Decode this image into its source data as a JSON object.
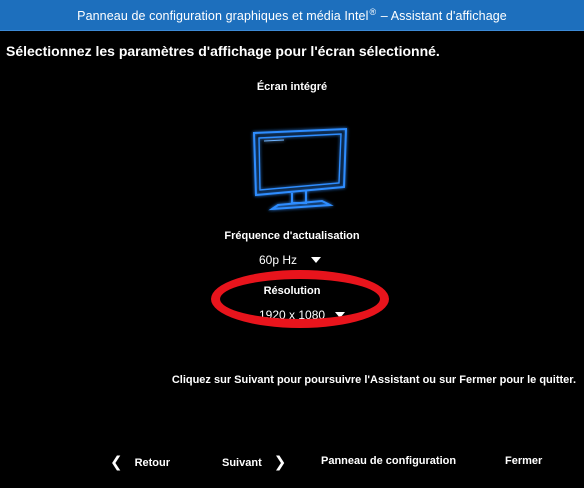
{
  "window": {
    "title_main": "Panneau de configuration graphiques et média Intel",
    "title_mark": "®",
    "title_sep": " – ",
    "title_section": "Assistant d'affichage"
  },
  "heading": "Sélectionnez les paramètres d'affichage pour l'écran sélectionné.",
  "display": {
    "name": "Écran intégré",
    "icon": "monitor-icon",
    "glow_color": "#2f8dff"
  },
  "refresh": {
    "label": "Fréquence d'actualisation",
    "value": "60p Hz"
  },
  "resolution": {
    "label": "Résolution",
    "value": "1920 x 1080",
    "highlight_color": "#e8141c"
  },
  "instruction": "Cliquez sur Suivant pour poursuivre l'Assistant ou sur Fermer pour le quitter.",
  "buttons": {
    "back": "Retour",
    "back_glyph": "❮",
    "next": "Suivant",
    "next_glyph": "❯",
    "panel": "Panneau de configuration",
    "close": "Fermer"
  }
}
